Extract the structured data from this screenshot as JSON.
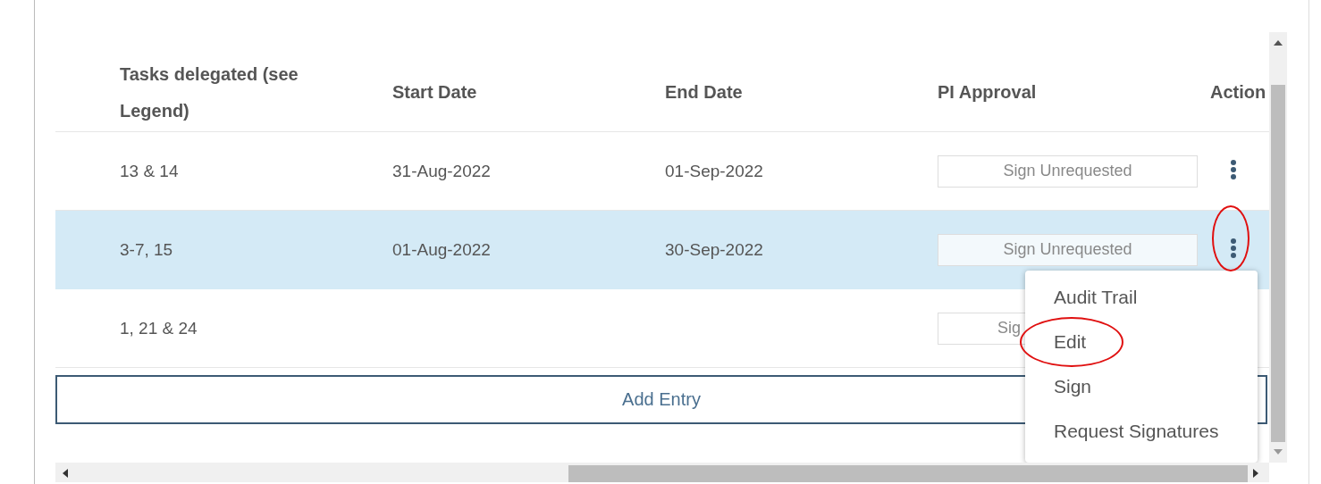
{
  "table": {
    "columns": [
      "Tasks delegated (see Legend)",
      "Start Date",
      "End Date",
      "PI Approval",
      "Action"
    ],
    "rows": [
      {
        "tasks": "13 & 14",
        "start_date": "31-Aug-2022",
        "end_date": "01-Sep-2022",
        "pi_approval": "Sign Unrequested",
        "selected": false,
        "action_marked": false
      },
      {
        "tasks": "3-7, 15",
        "start_date": "01-Aug-2022",
        "end_date": "30-Sep-2022",
        "pi_approval": "Sign Unrequested",
        "selected": true,
        "action_marked": true
      },
      {
        "tasks": "1, 21 & 24",
        "pi_approval": "Sig",
        "selected": false
      }
    ]
  },
  "add_button": "Add Entry",
  "action_menu": {
    "items": [
      {
        "label": "Audit Trail",
        "marked": false
      },
      {
        "label": "Edit",
        "marked": true
      },
      {
        "label": "Sign",
        "marked": false
      },
      {
        "label": "Request Signatures",
        "marked": false
      }
    ]
  }
}
